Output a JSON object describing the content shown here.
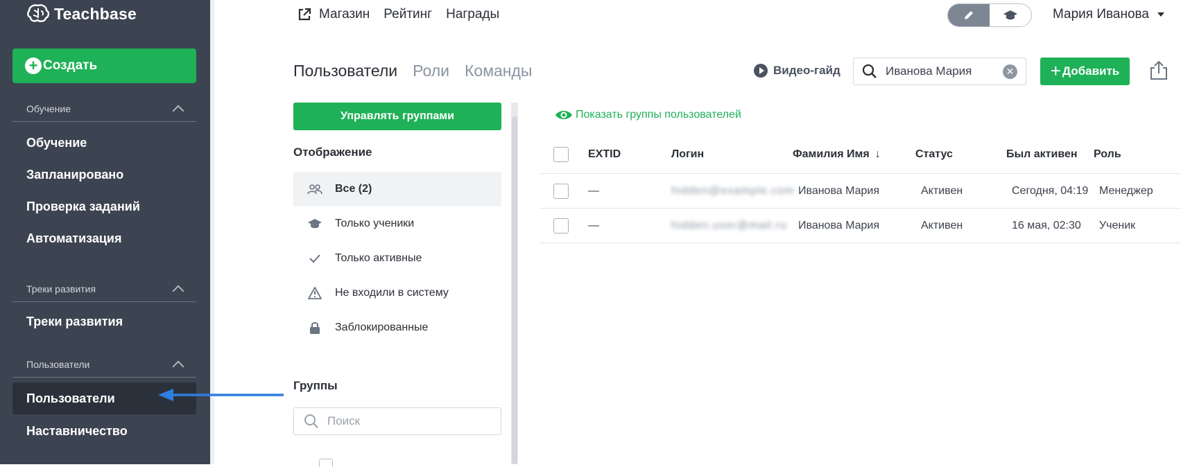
{
  "app": {
    "brand": "Teachbase"
  },
  "sidebar": {
    "create_label": "Создать",
    "sections": [
      {
        "title": "Обучение",
        "items": [
          "Обучение",
          "Запланировано",
          "Проверка заданий",
          "Автоматизация"
        ]
      },
      {
        "title": "Треки развития",
        "items": [
          "Треки развития"
        ]
      },
      {
        "title": "Пользователи",
        "items": [
          "Пользователи",
          "Наставничество"
        ]
      }
    ],
    "active_item": "Пользователи"
  },
  "topnav": {
    "items": [
      "Магазин",
      "Рейтинг",
      "Награды"
    ],
    "user_name": "Мария Иванова",
    "mode_icons": [
      "pencil-icon",
      "graduation-cap-icon"
    ],
    "active_mode": "pencil-icon"
  },
  "page": {
    "tabs": [
      "Пользователи",
      "Роли",
      "Команды"
    ],
    "active_tab": "Пользователи",
    "video_guide": "Видео-гайд",
    "search_value": "Иванова Мария",
    "add_label": "Добавить"
  },
  "filters": {
    "manage_groups_label": "Управлять группами",
    "display_title": "Отображение",
    "items": [
      {
        "label": "Все (2)",
        "icon": "users-icon",
        "active": true
      },
      {
        "label": "Только ученики",
        "icon": "graduation-cap-icon",
        "active": false
      },
      {
        "label": "Только активные",
        "icon": "check-icon",
        "active": false
      },
      {
        "label": "Не входили в систему",
        "icon": "warning-icon",
        "active": false
      },
      {
        "label": "Заблокированные",
        "icon": "lock-icon",
        "active": false
      }
    ],
    "groups_title": "Группы",
    "groups_search_placeholder": "Поиск"
  },
  "table": {
    "show_groups_label": "Показать группы пользователей",
    "columns": [
      "EXTID",
      "Логин",
      "Фамилия Имя",
      "Статус",
      "Был активен",
      "Роль"
    ],
    "rows": [
      {
        "extid": "—",
        "login": "hidden@example.com",
        "name": "Иванова Мария",
        "status": "Активен",
        "last_active": "Сегодня, 04:19",
        "role": "Менеджер"
      },
      {
        "extid": "—",
        "login": "hidden.user@mail.ru",
        "name": "Иванова Мария",
        "status": "Активен",
        "last_active": "16 мая, 02:30",
        "role": "Ученик"
      }
    ]
  },
  "colors": {
    "sidebar_bg": "#3c4451",
    "accent_green": "#1fb157",
    "annotation_blue": "#2f7de1"
  }
}
